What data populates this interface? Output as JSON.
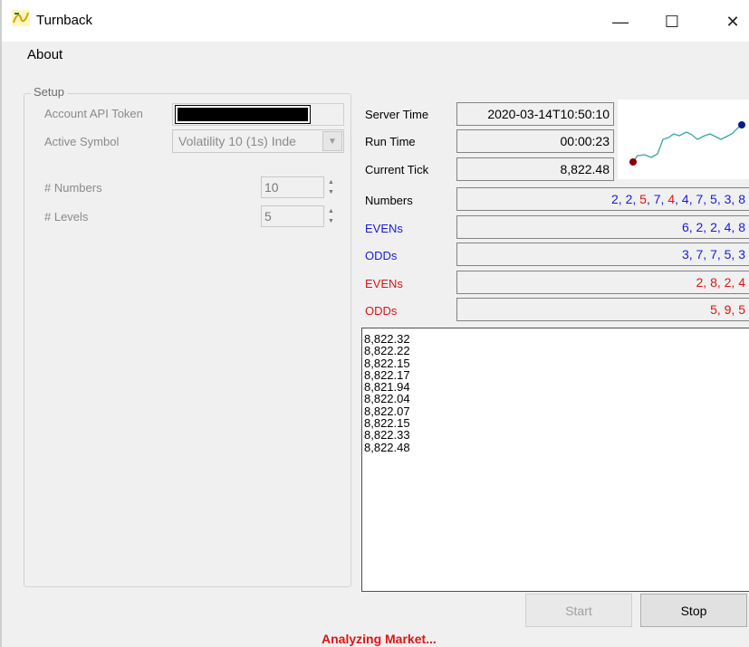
{
  "window": {
    "title": "Turnback",
    "minimize_glyph": "—",
    "maximize_glyph": "☐",
    "close_glyph": "✕"
  },
  "menu": {
    "about": "About"
  },
  "setup": {
    "legend": "Setup",
    "token_label": "Account API Token",
    "token_value_redacted": true,
    "symbol_label": "Active Symbol",
    "symbol_value": "Volatility 10 (1s) Inde",
    "numbers_label": "# Numbers",
    "numbers_value": "10",
    "levels_label": "# Levels",
    "levels_value": "5"
  },
  "info": {
    "server_time_label": "Server Time",
    "server_time_value": "2020-03-14T10:50:10",
    "run_time_label": "Run Time",
    "run_time_value": "00:00:23",
    "current_tick_label": "Current Tick",
    "current_tick_value": "8,822.48",
    "numbers_label": "Numbers",
    "numbers_digits": [
      {
        "d": "2",
        "c": "blue"
      },
      {
        "d": "2",
        "c": "blue"
      },
      {
        "d": "5",
        "c": "red"
      },
      {
        "d": "7",
        "c": "blue"
      },
      {
        "d": "4",
        "c": "red"
      },
      {
        "d": "4",
        "c": "blue"
      },
      {
        "d": "7",
        "c": "blue"
      },
      {
        "d": "5",
        "c": "blue"
      },
      {
        "d": "3",
        "c": "blue"
      },
      {
        "d": "8",
        "c": "blue"
      }
    ],
    "evens_blue_label": "EVENs",
    "evens_blue_value": "6, 2, 2, 4, 8",
    "odds_blue_label": "ODDs",
    "odds_blue_value": "3, 7, 7, 5, 3",
    "evens_red_label": "EVENs",
    "evens_red_value": "2, 8, 2, 4",
    "odds_red_label": "ODDs",
    "odds_red_value": "5, 9, 5"
  },
  "ticks": [
    "8,822.32",
    "8,822.22",
    "8,822.15",
    "8,822.17",
    "8,821.94",
    "8,822.04",
    "8,822.07",
    "8,822.15",
    "8,822.33",
    "8,822.48"
  ],
  "buttons": {
    "start": "Start",
    "stop": "Stop"
  },
  "status_text": "Analyzing Market...",
  "colors": {
    "blue": "#1a1adb",
    "red": "#e01414",
    "spark_line": "#3aa6a6",
    "spark_start": "#8b0000",
    "spark_end": "#0b1a8a"
  }
}
